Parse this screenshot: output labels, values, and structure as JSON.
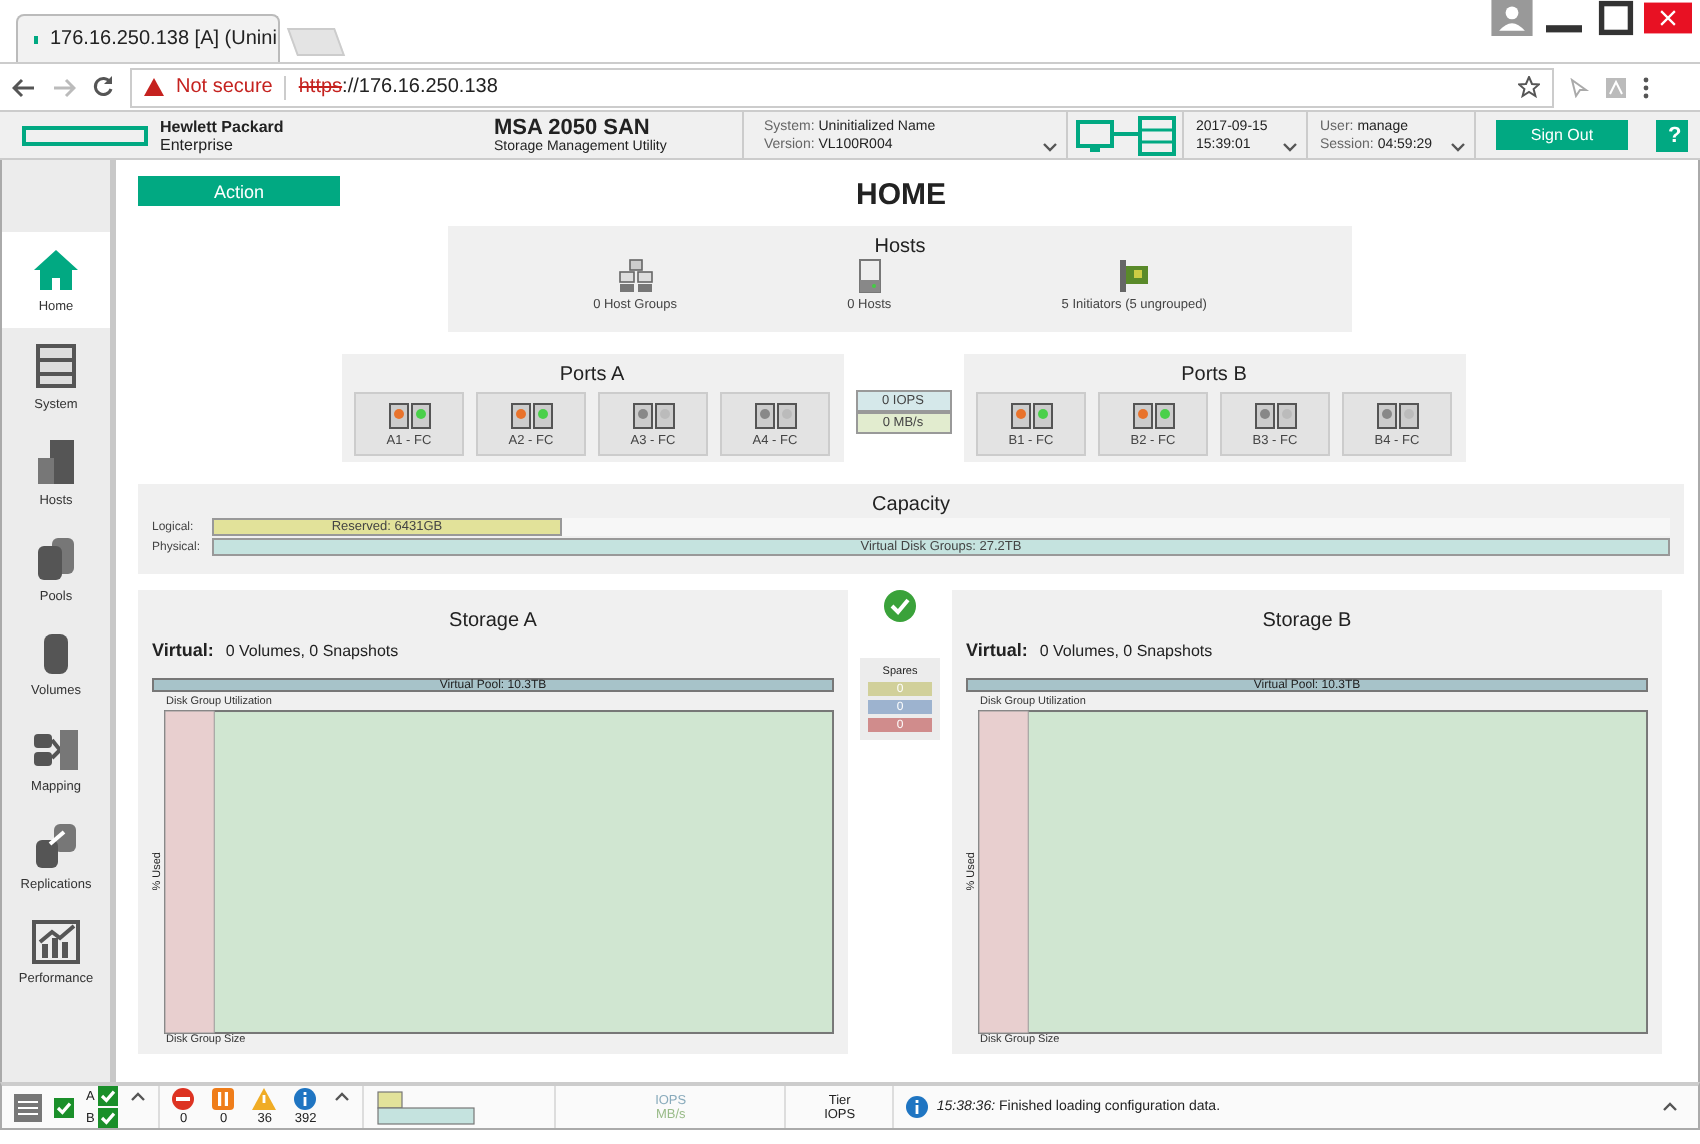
{
  "browser": {
    "tab_title": "176.16.250.138 [A] (Unini",
    "security_label": "Not secure",
    "url_scheme": "https",
    "url_rest": "://176.16.250.138"
  },
  "header": {
    "brand": [
      "Hewlett Packard",
      "Enterprise"
    ],
    "product": "MSA 2050 SAN",
    "subtitle": "Storage Management Utility",
    "system_label": "System:",
    "system_value": "Uninitialized Name",
    "version_label": "Version:",
    "version_value": "VL100R004",
    "date": "2017-09-15",
    "time": "15:39:01",
    "user_label": "User:",
    "user_value": "manage",
    "session_label": "Session:",
    "session_value": "04:59:29",
    "sign_out": "Sign Out",
    "help": "?"
  },
  "sidebar": {
    "items": [
      {
        "label": "Home",
        "kind": "home",
        "selected": true
      },
      {
        "label": "System",
        "kind": "system",
        "selected": false
      },
      {
        "label": "Hosts",
        "kind": "hosts",
        "selected": false
      },
      {
        "label": "Pools",
        "kind": "pools",
        "selected": false
      },
      {
        "label": "Volumes",
        "kind": "volumes",
        "selected": false
      },
      {
        "label": "Mapping",
        "kind": "mapping",
        "selected": false
      },
      {
        "label": "Replications",
        "kind": "replications",
        "selected": false
      },
      {
        "label": "Performance",
        "kind": "performance",
        "selected": false
      }
    ]
  },
  "main": {
    "action": "Action",
    "title": "HOME",
    "hosts": {
      "title": "Hosts",
      "items": [
        {
          "label": "0 Host Groups",
          "kind": "group"
        },
        {
          "label": "0 Hosts",
          "kind": "host"
        },
        {
          "label": "5 Initiators (5 ungrouped)",
          "kind": "initiator"
        }
      ]
    },
    "ports": [
      {
        "title": "Ports A",
        "ports": [
          {
            "label": "A1 - FC",
            "connected": true
          },
          {
            "label": "A2 - FC",
            "connected": true
          },
          {
            "label": "A3 - FC",
            "connected": false
          },
          {
            "label": "A4 - FC",
            "connected": false
          }
        ]
      },
      {
        "title": "Ports B",
        "ports": [
          {
            "label": "B1 - FC",
            "connected": true
          },
          {
            "label": "B2 - FC",
            "connected": true
          },
          {
            "label": "B3 - FC",
            "connected": false
          },
          {
            "label": "B4 - FC",
            "connected": false
          }
        ]
      }
    ],
    "throughput": {
      "iops": "0 IOPS",
      "mbs": "0 MB/s"
    },
    "capacity": {
      "title": "Capacity",
      "bars": [
        {
          "label": "Logical:",
          "text": "Reserved: 6431GB",
          "level": 0.24,
          "kind": "logical"
        },
        {
          "label": "Physical:",
          "text": "Virtual Disk Groups: 27.2TB",
          "level": 1,
          "kind": "physical"
        }
      ]
    },
    "storage": [
      {
        "title": "Storage A",
        "virtual_label": "Virtual:",
        "virtual_value": "0 Volumes, 0 Snapshots",
        "pool": "Virtual Pool: 10.3TB",
        "util_label": "Disk Group Utilization",
        "y_label": "% Used",
        "x_label": "Disk Group Size"
      },
      {
        "title": "Storage B",
        "virtual_label": "Virtual:",
        "virtual_value": "0 Volumes, 0 Snapshots",
        "pool": "Virtual Pool: 10.3TB",
        "util_label": "Disk Group Utilization",
        "y_label": "% Used",
        "x_label": "Disk Group Size"
      }
    ],
    "spares": {
      "title": "Spares",
      "values": [
        {
          "value": "0",
          "color": "#d1d09a"
        },
        {
          "value": "0",
          "color": "#9db3cf"
        },
        {
          "value": "0",
          "color": "#d08c8c"
        }
      ]
    }
  },
  "footer": {
    "controllers": [
      {
        "label": "A",
        "ok": true
      },
      {
        "label": "B",
        "ok": true
      }
    ],
    "alerts": [
      {
        "kind": "critical",
        "count": "0"
      },
      {
        "kind": "error",
        "count": "0"
      },
      {
        "kind": "warning",
        "count": "36"
      },
      {
        "kind": "info",
        "count": "392"
      }
    ],
    "iops": "IOPS",
    "mbs": "MB/s",
    "tier": "Tier",
    "tier_iops": "IOPS",
    "message_time": "15:38:36:",
    "message": "Finished loading configuration data."
  }
}
